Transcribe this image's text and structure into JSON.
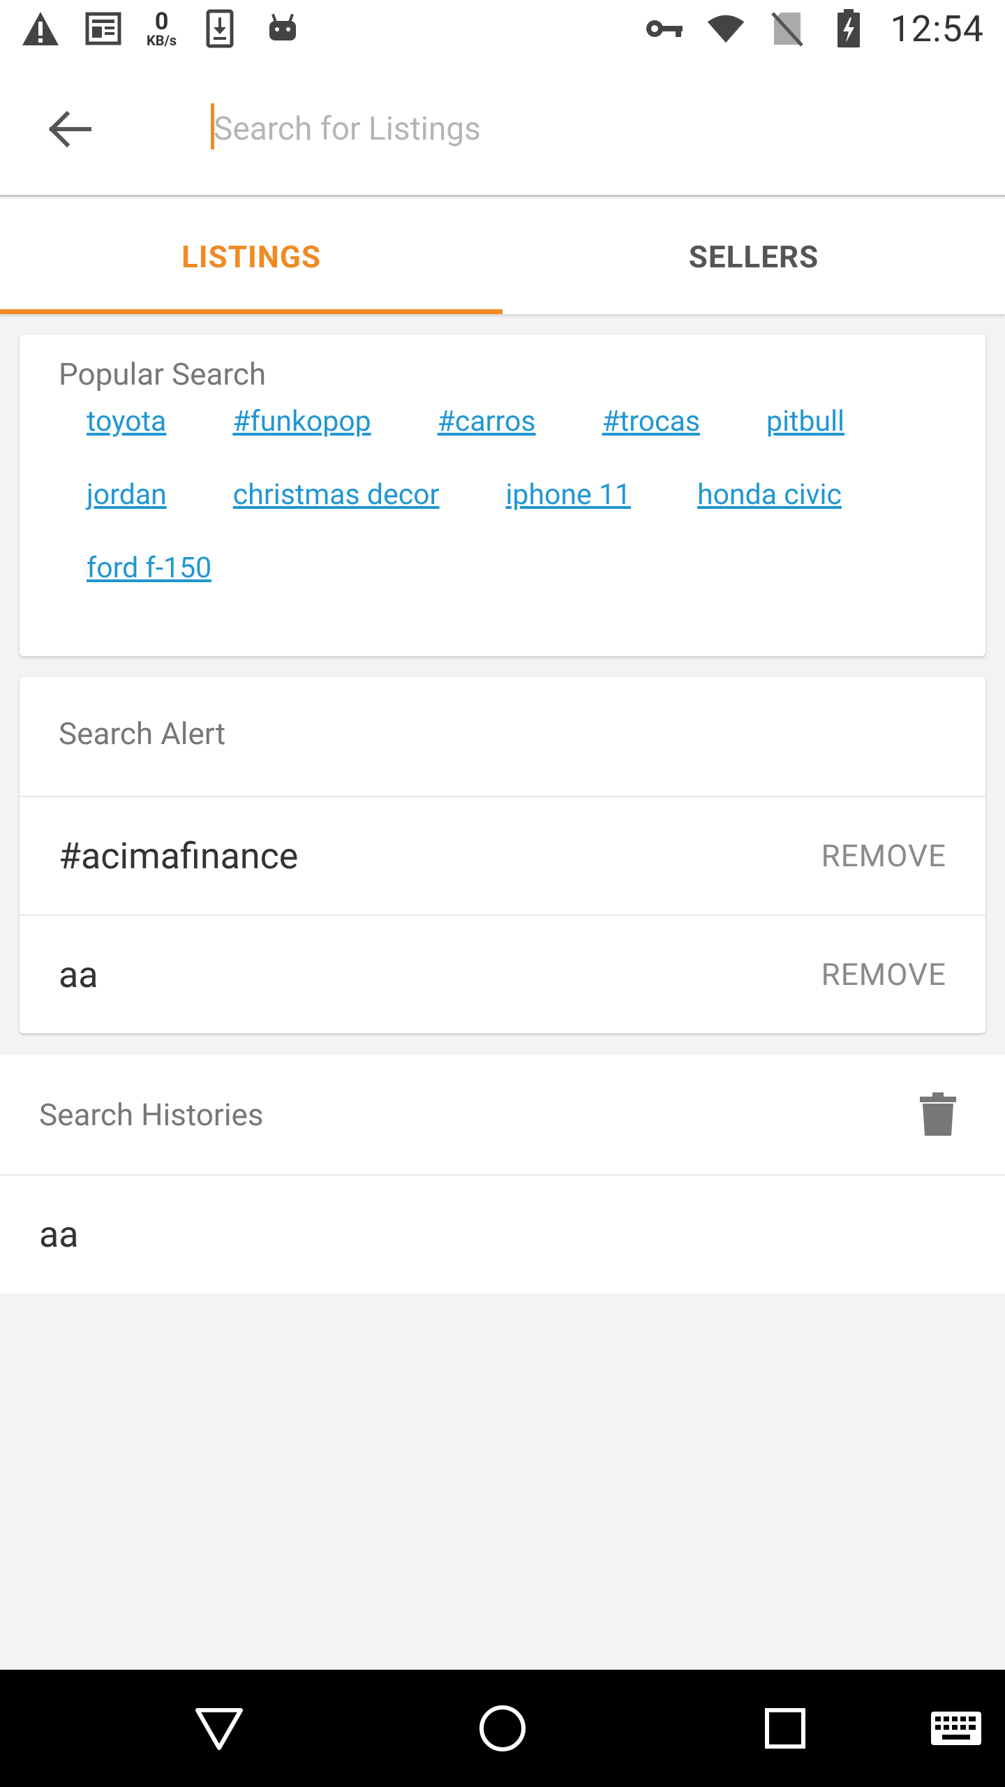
{
  "status_bar": {
    "net_speed_value": "0",
    "net_speed_unit": "KB/s",
    "time": "12:54",
    "left_icons": [
      "warning-icon",
      "news-icon",
      "net-speed-icon",
      "download-icon",
      "android-icon"
    ],
    "right_icons": [
      "vpn-key-icon",
      "wifi-icon",
      "no-sim-icon",
      "battery-charging-icon"
    ]
  },
  "search": {
    "placeholder": "Search for Listings",
    "value": "",
    "caret_color": "#f08a24"
  },
  "tabs": [
    {
      "label": "LISTINGS",
      "active": true
    },
    {
      "label": "SELLERS",
      "active": false
    }
  ],
  "popular_search": {
    "title": "Popular Search",
    "tags": [
      "toyota",
      "#funkopop",
      "#carros",
      "#trocas",
      "pitbull",
      "jordan",
      "christmas decor",
      "iphone 11",
      "honda civic",
      "ford f-150"
    ]
  },
  "search_alert": {
    "title": "Search Alert",
    "items": [
      {
        "term": "#acimafinance",
        "action": "REMOVE"
      },
      {
        "term": "aa",
        "action": "REMOVE"
      }
    ]
  },
  "search_histories": {
    "title": "Search Histories",
    "items": [
      {
        "term": "aa"
      }
    ]
  },
  "nav_bar": {
    "buttons": [
      "back-triangle-icon",
      "home-circle-icon",
      "recents-square-icon",
      "keyboard-icon"
    ]
  },
  "colors": {
    "accent": "#f08a24",
    "link": "#2196d3",
    "muted_text": "#777777",
    "background": "#f3f3f3"
  }
}
